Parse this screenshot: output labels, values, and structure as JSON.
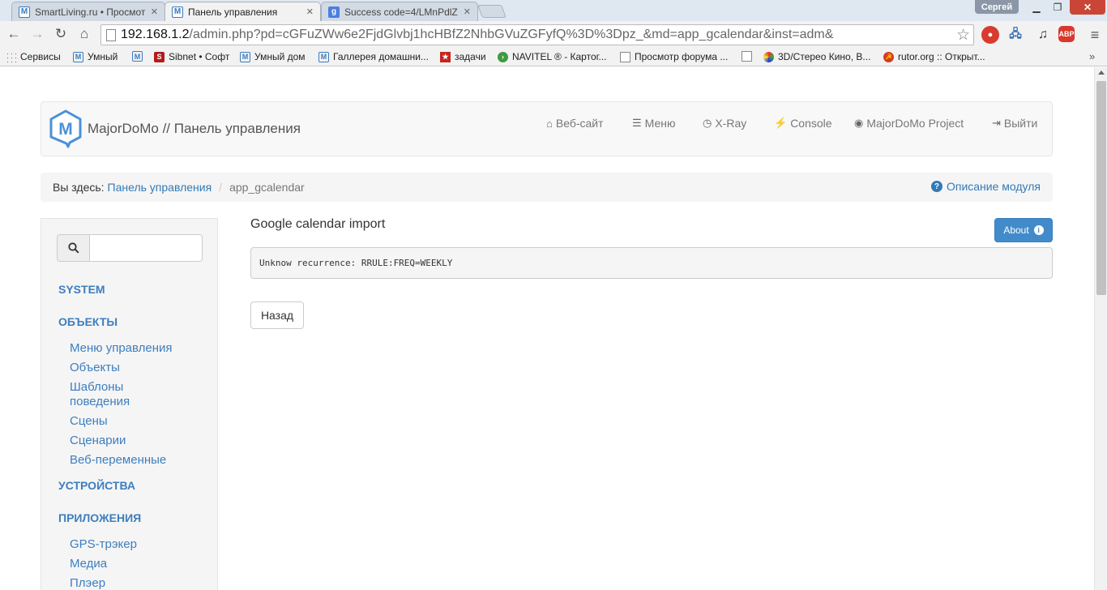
{
  "browser": {
    "tabs": [
      {
        "title": "SmartLiving.ru • Просмот",
        "icon": "majordomo-favicon",
        "active": false
      },
      {
        "title": "Панель управления",
        "icon": "majordomo-favicon",
        "active": true
      },
      {
        "title": "Success code=4/LMnPdlZ",
        "icon": "google-favicon",
        "active": false
      }
    ],
    "profile_name": "Сергей",
    "url_host": "192.168.1.2",
    "url_rest": "/admin.php?pd=cGFuZWw6e2FjdGlvbj1hcHBfZ2NhbGVuZGFyfQ%3D%3Dpz_&md=app_gcalendar&inst=adm&",
    "bookmarks": [
      {
        "label": "Сервисы",
        "icon": "apps-icon"
      },
      {
        "label": "Умный",
        "icon": "majordomo-favicon"
      },
      {
        "label": "",
        "icon": "majordomo-favicon"
      },
      {
        "label": "Sibnet • Софт",
        "icon": "sibnet-icon"
      },
      {
        "label": "Умный дом",
        "icon": "majordomo-favicon"
      },
      {
        "label": "Галлерея домашни...",
        "icon": "majordomo-favicon"
      },
      {
        "label": "задачи",
        "icon": "star-bookmark-icon"
      },
      {
        "label": "NAVITEL ® - Картог...",
        "icon": "navitel-icon"
      },
      {
        "label": "Просмотр форума ...",
        "icon": "page-icon"
      },
      {
        "label": "",
        "icon": "page-icon"
      },
      {
        "label": "3D/Стерео Кино, В...",
        "icon": "3d-icon"
      },
      {
        "label": "rutor.org :: Открыт...",
        "icon": "rutor-icon"
      }
    ],
    "ext_abp": "ABP"
  },
  "header": {
    "brand": "MajorDoMo // Панель управления",
    "logo_letter": "M",
    "nav": [
      {
        "label": "Веб-сайт",
        "icon": "home-icon"
      },
      {
        "label": "Меню",
        "icon": "list-icon"
      },
      {
        "label": "X-Ray",
        "icon": "clock-icon"
      },
      {
        "label": "Console",
        "icon": "bolt-icon"
      },
      {
        "label": "MajorDoMo Project",
        "icon": "globe-icon"
      },
      {
        "label": "Выйти",
        "icon": "logout-icon"
      }
    ]
  },
  "breadcrumb": {
    "prefix": "Вы здесь:",
    "link": "Панель управления",
    "separator": "/",
    "current": "app_gcalendar",
    "help": "Описание модуля"
  },
  "sidebar": {
    "search_value": "",
    "sections": [
      {
        "title": "SYSTEM",
        "items": []
      },
      {
        "title": "ОБЪЕКТЫ",
        "items": [
          "Меню управления",
          "Объекты",
          "Шаблоны поведения",
          "Сцены",
          "Сценарии",
          "Веб-переменные"
        ]
      },
      {
        "title": "УСТРОЙСТВА",
        "items": []
      },
      {
        "title": "ПРИЛОЖЕНИЯ",
        "items": [
          "GPS-трэкер",
          "Медиа",
          "Плэер"
        ]
      }
    ]
  },
  "main": {
    "title": "Google calendar import",
    "about_label": "About",
    "message": "Unknow recurrence: RRULE:FREQ=WEEKLY",
    "back_label": "Назад"
  },
  "colors": {
    "link": "#337ab7",
    "sidebar_link": "#3d7ebf",
    "primary_button": "#428bca"
  }
}
